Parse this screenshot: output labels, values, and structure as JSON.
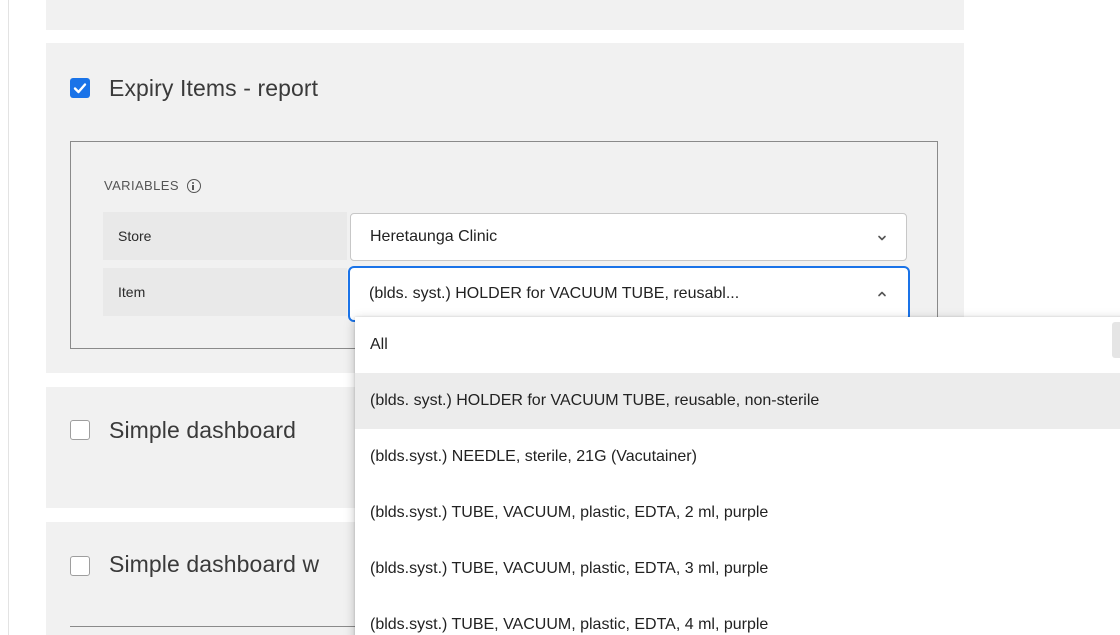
{
  "sections": {
    "expiry": {
      "title": "Expiry Items - report",
      "checked": true,
      "variables_heading": "VARIABLES",
      "variables": [
        {
          "label": "Store",
          "value": "Heretaunga Clinic"
        },
        {
          "label": "Item",
          "value": "(blds. syst.) HOLDER for VACUUM TUBE, reusabl..."
        }
      ]
    },
    "simple_dashboard": {
      "title": "Simple dashboard",
      "checked": false
    },
    "simple_dashboard_w": {
      "title": "Simple dashboard w",
      "checked": false
    }
  },
  "dropdown": {
    "selected_index": 1,
    "options": [
      "All",
      "(blds. syst.) HOLDER for VACUUM TUBE, reusable, non-sterile",
      "(blds.syst.) NEEDLE, sterile, 21G (Vacutainer)",
      "(blds.syst.) TUBE, VACUUM, plastic, EDTA, 2 ml, purple",
      "(blds.syst.) TUBE, VACUUM, plastic, EDTA, 3 ml, purple",
      "(blds.syst.) TUBE, VACUUM, plastic, EDTA, 4 ml, purple"
    ]
  },
  "colors": {
    "accent": "#1a73e8",
    "card_background": "#f1f1f1"
  }
}
